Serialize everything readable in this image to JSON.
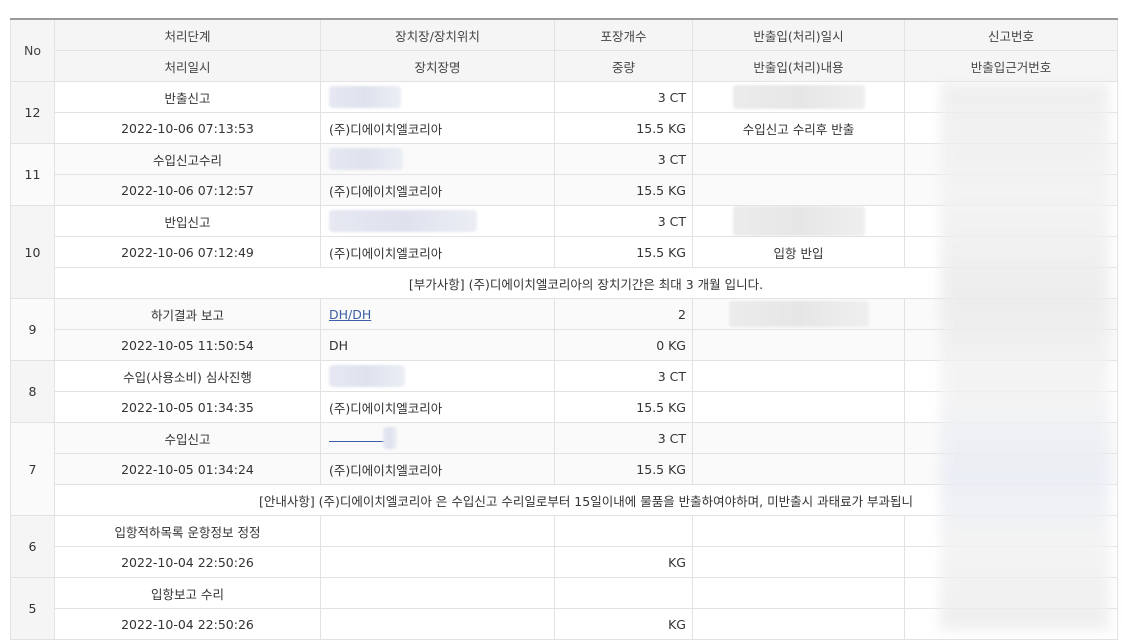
{
  "header": {
    "no": "No",
    "row1": [
      "처리단계",
      "장치장/장치위치",
      "포장개수",
      "반출입(처리)일시",
      "신고번호"
    ],
    "row2": [
      "처리일시",
      "장치장명",
      "중량",
      "반출입(처리)내용",
      "반출입근거번호"
    ]
  },
  "entries": [
    {
      "no": "12",
      "stage": "반출신고",
      "datetime": "2022-10-06 07:13:53",
      "warehouse": "(주)디에이치엘코리아",
      "pkg": "3 CT",
      "weight": "15.5 KG",
      "content": "수입신고 수리후 반출"
    },
    {
      "no": "11",
      "stage": "수입신고수리",
      "datetime": "2022-10-06 07:12:57",
      "warehouse": "(주)디에이치엘코리아",
      "pkg": "3 CT",
      "weight": "15.5 KG",
      "content": ""
    },
    {
      "no": "10",
      "stage": "반입신고",
      "datetime": "2022-10-06 07:12:49",
      "warehouse": "(주)디에이치엘코리아",
      "pkg": "3 CT",
      "weight": "15.5 KG",
      "content": "입항 반입",
      "note": "[부가사항] (주)디에이치엘코리아의 장치기간은 최대 3 개월 입니다."
    },
    {
      "no": "9",
      "stage": "하기결과 보고",
      "datetime": "2022-10-05 11:50:54",
      "location_link": "DH/DH",
      "warehouse": "DH",
      "pkg": "2",
      "weight": "0 KG",
      "content": ""
    },
    {
      "no": "8",
      "stage": "수입(사용소비) 심사진행",
      "datetime": "2022-10-05 01:34:35",
      "warehouse": "(주)디에이치엘코리아",
      "pkg": "3 CT",
      "weight": "15.5 KG",
      "content": ""
    },
    {
      "no": "7",
      "stage": "수입신고",
      "datetime": "2022-10-05 01:34:24",
      "warehouse": "(주)디에이치엘코리아",
      "pkg": "3 CT",
      "weight": "15.5 KG",
      "content": "",
      "note": "[안내사항] (주)디에이치엘코리아 은 수입신고 수리일로부터 15일이내에 물품을 반출하여야하며, 미반출시 과태료가 부과됩니"
    },
    {
      "no": "6",
      "stage": "입항적하목록 운항정보 정정",
      "datetime": "2022-10-04 22:50:26",
      "warehouse": "",
      "pkg": "",
      "weight": "KG",
      "content": ""
    },
    {
      "no": "5",
      "stage": "입항보고 수리",
      "datetime": "2022-10-04 22:50:26",
      "warehouse": "",
      "pkg": "",
      "weight": "KG",
      "content": ""
    }
  ]
}
